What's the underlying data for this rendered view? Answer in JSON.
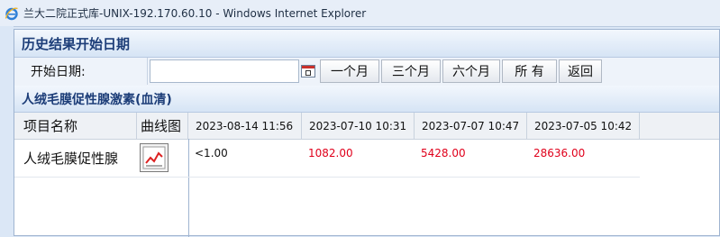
{
  "window": {
    "title": "兰大二院正式库-UNIX-192.170.60.10 - Windows Internet Explorer"
  },
  "history_section": {
    "title": "历史结果开始日期",
    "start_date_label": "开始日期:",
    "start_date_value": "",
    "buttons": [
      "一个月",
      "三个月",
      "六个月",
      "所 有",
      "返回"
    ]
  },
  "test_section": {
    "title": "人绒毛膜促性腺激素(血清)",
    "columns": {
      "item_name": "项目名称",
      "chart": "曲线图",
      "dates": [
        "2023-08-14 11:56",
        "2023-07-10 10:31",
        "2023-07-07 10:47",
        "2023-07-05 10:42"
      ]
    },
    "rows": [
      {
        "name": "人绒毛膜促性腺",
        "values": [
          "<1.00",
          "1082.00",
          "5428.00",
          "28636.00"
        ],
        "abnormal": [
          false,
          true,
          true,
          true
        ]
      }
    ]
  },
  "colors": {
    "abnormal": "#e0001b",
    "normal": "#111111",
    "header_text": "#1c3d78"
  },
  "icons": {
    "browser": "ie-icon",
    "calendar": "calendar-icon",
    "trend_chart": "trend-chart-icon"
  }
}
